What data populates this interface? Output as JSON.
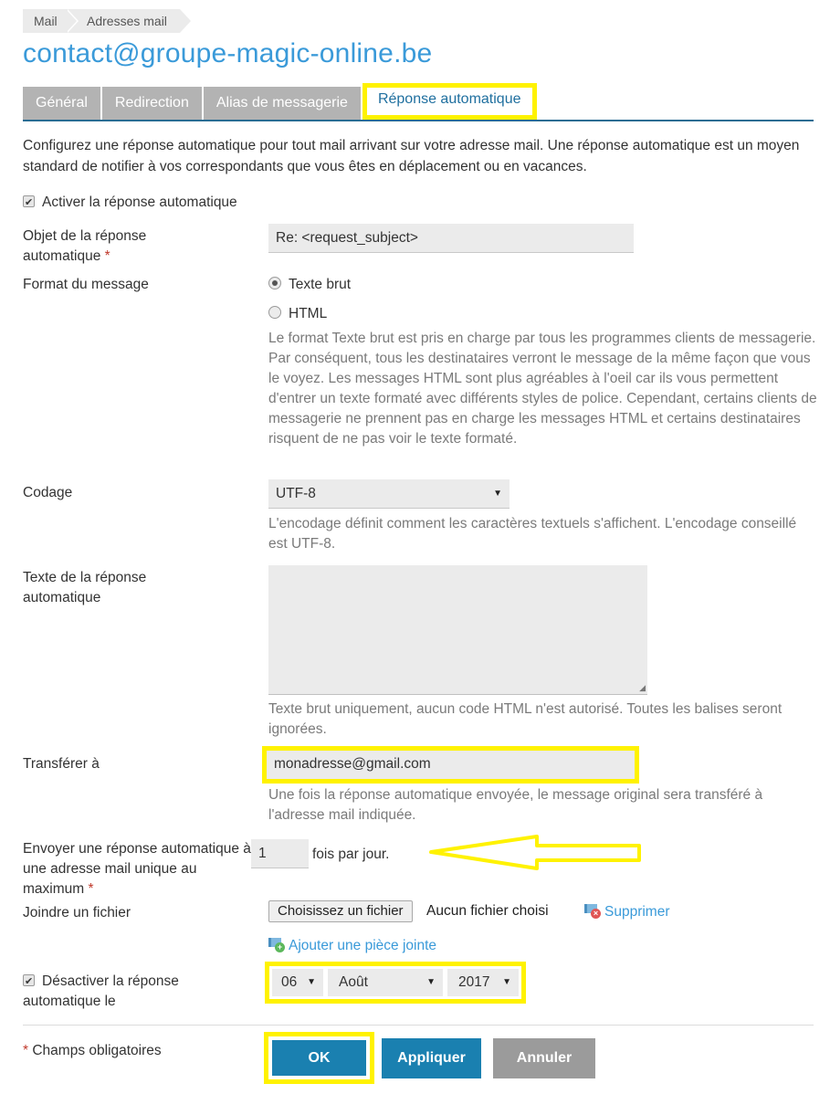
{
  "breadcrumb": [
    "Mail",
    "Adresses mail"
  ],
  "page_title": "contact@groupe-magic-online.be",
  "tabs": [
    {
      "label": "Général",
      "active": false
    },
    {
      "label": "Redirection",
      "active": false
    },
    {
      "label": "Alias de messagerie",
      "active": false
    },
    {
      "label": "Réponse automatique",
      "active": true
    }
  ],
  "intro": "Configurez une réponse automatique pour tout mail arrivant sur votre adresse mail. Une réponse automatique est un moyen standard de notifier à vos correspondants que vous êtes en déplacement ou en vacances.",
  "form": {
    "enable": {
      "label": "Activer la réponse automatique",
      "checked": true
    },
    "subject": {
      "label": "Objet de la réponse automatique",
      "required_mark": "*",
      "value": "Re: <request_subject>"
    },
    "format": {
      "label": "Format du message",
      "options": [
        {
          "label": "Texte brut",
          "checked": true
        },
        {
          "label": "HTML",
          "checked": false
        }
      ],
      "help": "Le format Texte brut est pris en charge par tous les programmes clients de messagerie. Par conséquent, tous les destinataires verront le message de la même façon que vous le voyez. Les messages HTML sont plus agréables à l'oeil car ils vous permettent d'entrer un texte formaté avec différents styles de police. Cependant, certains clients de messagerie ne prennent pas en charge les messages HTML et certains destinataires risquent de ne pas voir le texte formaté."
    },
    "encoding": {
      "label": "Codage",
      "value": "UTF-8",
      "help": "L'encodage définit comment les caractères textuels s'affichent. L'encodage conseillé est UTF-8."
    },
    "body": {
      "label": "Texte de la réponse automatique",
      "value": "",
      "help": "Texte brut uniquement, aucun code HTML n'est autorisé. Toutes les balises seront ignorées."
    },
    "forward": {
      "label": "Transférer à",
      "value": "monadresse@gmail.com",
      "help": "Une fois la réponse automatique envoyée, le message original sera transféré à l'adresse mail indiquée."
    },
    "frequency": {
      "label": "Envoyer une réponse automatique à une adresse mail unique au maximum",
      "required_mark": "*",
      "value": "1",
      "suffix": "fois par jour."
    },
    "attachment": {
      "label": "Joindre un fichier",
      "button": "Choisissez un fichier",
      "status": "Aucun fichier choisi",
      "remove": "Supprimer",
      "add": "Ajouter une pièce jointe"
    },
    "deactivate": {
      "label": "Désactiver la réponse automatique le",
      "checked": true,
      "day": "06",
      "month": "Août",
      "year": "2017"
    }
  },
  "footer": {
    "required_note_mark": "*",
    "required_note": "Champs obligatoires",
    "ok": "OK",
    "apply": "Appliquer",
    "cancel": "Annuler"
  },
  "colors": {
    "accent": "#3a9ad9",
    "primary_button": "#1a80b0",
    "cancel_button": "#9b9b9b",
    "highlight": "#fff200",
    "tab_inactive": "#b3b3b3"
  }
}
